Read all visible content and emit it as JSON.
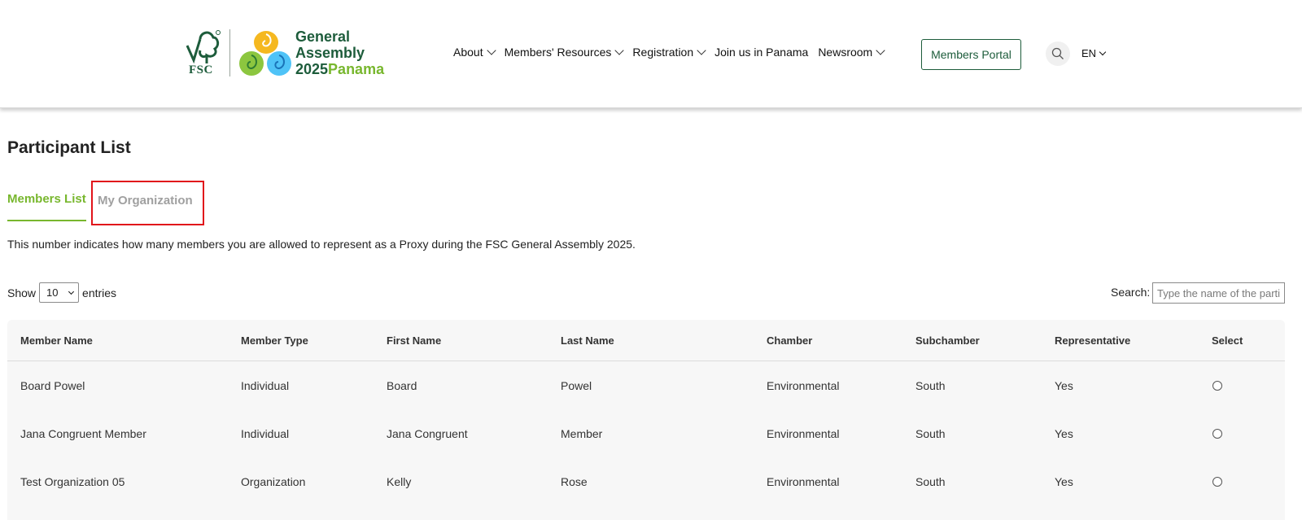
{
  "header": {
    "logo": {
      "fsc_text": "FSC",
      "ga_line1": "General",
      "ga_line2": "Assembly",
      "ga_line3_year": "2025",
      "ga_line3_place": "Panama"
    },
    "nav": [
      {
        "label": "About",
        "dropdown": true
      },
      {
        "label": "Members' Resources",
        "dropdown": true
      },
      {
        "label": "Registration",
        "dropdown": true
      },
      {
        "label": "Join us in Panama",
        "dropdown": false
      },
      {
        "label": "Newsroom",
        "dropdown": true
      }
    ],
    "portal_button": "Members Portal",
    "search_icon": "search-icon",
    "language": "EN"
  },
  "page": {
    "title": "Participant List",
    "tabs": {
      "members_list": "Members List",
      "my_organization": "My Organization"
    },
    "info_text": "This number indicates how many members you are allowed to represent as a Proxy during the FSC General Assembly 2025.",
    "show_label": "Show",
    "entries_value": "10",
    "entries_label": "entries",
    "search_label": "Search:",
    "search_placeholder": "Type the name of the participant"
  },
  "table": {
    "headers": [
      "Member Name",
      "Member Type",
      "First Name",
      "Last Name",
      "Chamber",
      "Subchamber",
      "Representative",
      "Select"
    ],
    "rows": [
      [
        "Board Powel",
        "Individual",
        "Board",
        "Powel",
        "Environmental",
        "South",
        "Yes"
      ],
      [
        "Jana Congruent Member",
        "Individual",
        "Jana Congruent",
        "Member",
        "Environmental",
        "South",
        "Yes"
      ],
      [
        "Test Organization 05",
        "Organization",
        "Kelly",
        "Rose",
        "Environmental",
        "South",
        "Yes"
      ]
    ]
  },
  "colors": {
    "brand_dark_green": "#1d5c3b",
    "brand_light_green": "#78b72e",
    "highlight_red": "#e1141b",
    "inactive_tab_gray": "#a0a0a0"
  }
}
